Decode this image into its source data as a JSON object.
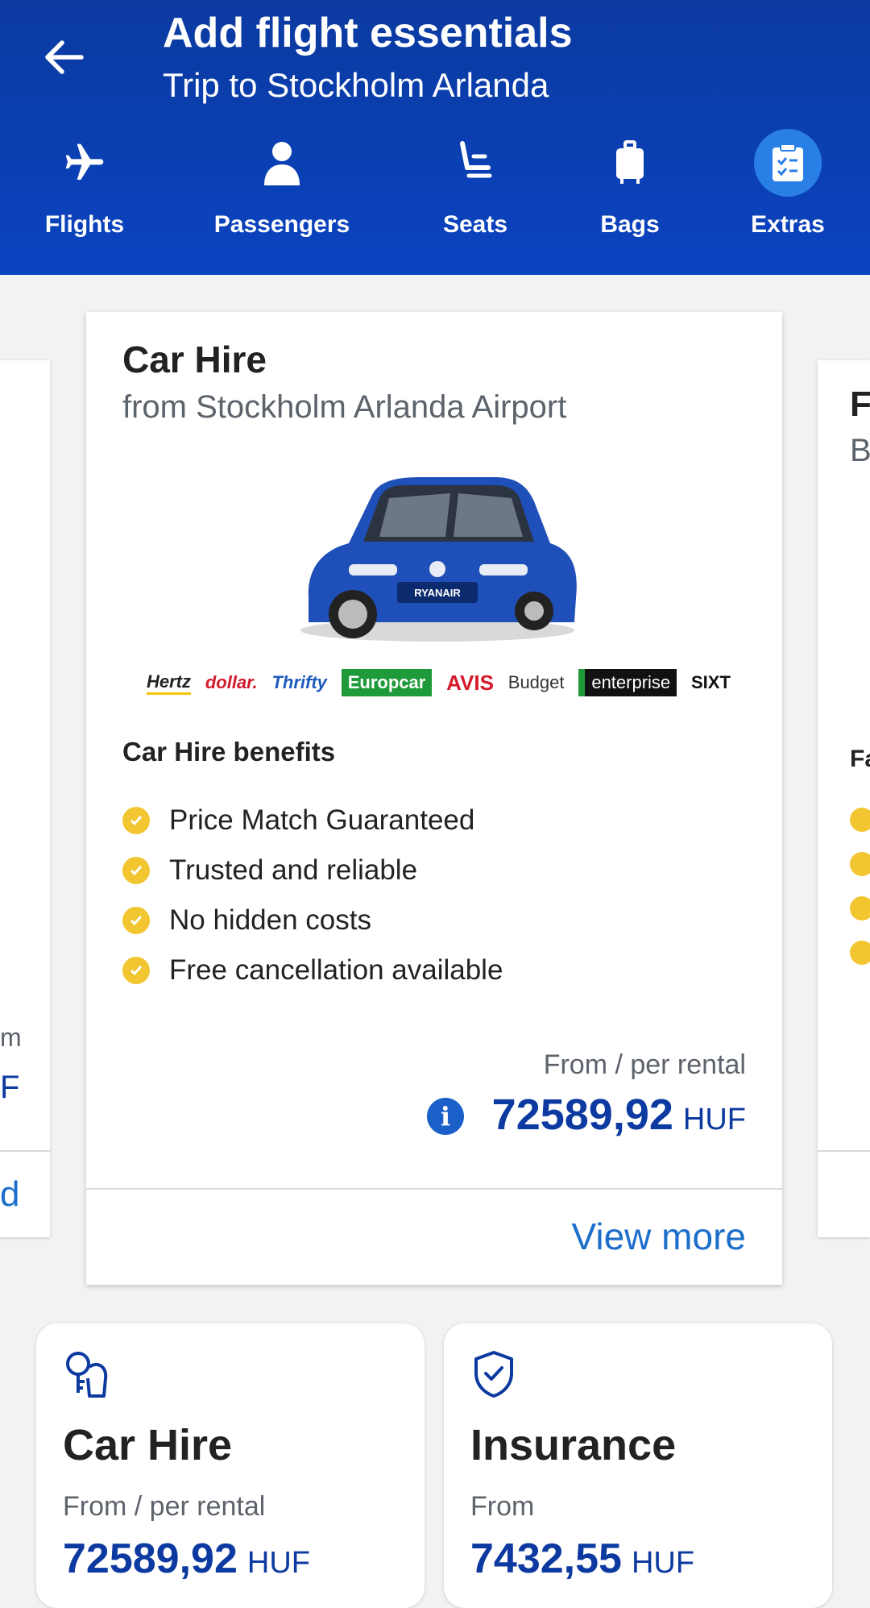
{
  "header": {
    "title": "Add flight essentials",
    "subtitle": "Trip to Stockholm Arlanda",
    "tabs": [
      {
        "label": "Flights",
        "icon": "plane-icon"
      },
      {
        "label": "Passengers",
        "icon": "person-icon"
      },
      {
        "label": "Seats",
        "icon": "seat-icon"
      },
      {
        "label": "Bags",
        "icon": "bag-icon"
      },
      {
        "label": "Extras",
        "icon": "clipboard-icon",
        "active": true
      }
    ]
  },
  "carousel": {
    "left_card": {
      "text_fragment_1": "m",
      "text_fragment_2": "F",
      "action_fragment": "d"
    },
    "main_card": {
      "title": "Car Hire",
      "subtitle": "from Stockholm Arlanda Airport",
      "brands": [
        "Hertz",
        "dollar.",
        "Thrifty",
        "Europcar",
        "AVIS",
        "Budget",
        "enterprise",
        "SIXT"
      ],
      "car_plate": "RYANAIR",
      "benefits_title": "Car Hire benefits",
      "benefits": [
        "Price Match Guaranteed",
        "Trusted and reliable",
        "No hidden costs",
        "Free cancellation available"
      ],
      "price_label": "From / per rental",
      "price_value": "72589,92",
      "currency": "HUF",
      "view_more": "View more"
    },
    "right_card": {
      "title_fragment": "F",
      "sub_fragment": "B",
      "benefits_fragment": "Fa"
    }
  },
  "tiles": [
    {
      "name": "Car Hire",
      "from": "From / per rental",
      "price": "72589,92",
      "currency": "HUF",
      "icon": "keys-icon"
    },
    {
      "name": "Insurance",
      "from": "From",
      "price": "7432,55",
      "currency": "HUF",
      "icon": "shield-check-icon"
    }
  ],
  "colors": {
    "header": "#0b44c1",
    "accent_blue": "#0d3aa0",
    "link": "#1b6ec9",
    "check_yellow": "#f2c631"
  }
}
